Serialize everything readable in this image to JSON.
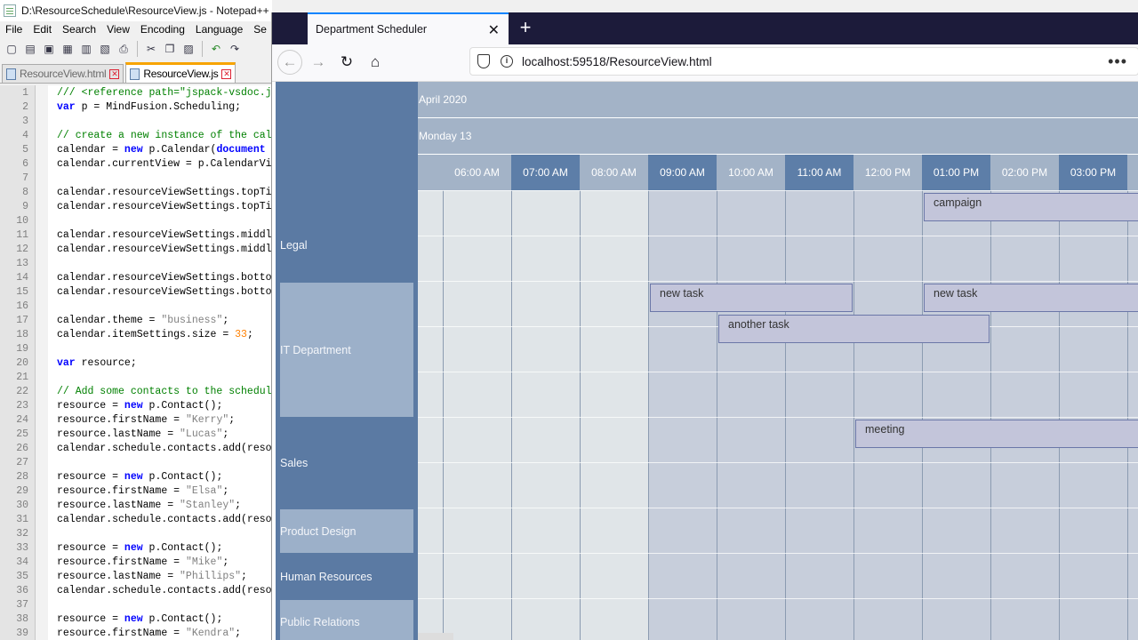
{
  "notepad": {
    "title": "D:\\ResourceSchedule\\ResourceView.js - Notepad++",
    "menu": [
      "File",
      "Edit",
      "Search",
      "View",
      "Encoding",
      "Language",
      "Se"
    ],
    "tabs": [
      {
        "label": "ResourceView.html",
        "active": false
      },
      {
        "label": "ResourceView.js",
        "active": true
      }
    ],
    "lines": [
      {
        "n": "1",
        "parts": [
          [
            "cm",
            "/// <reference path=\"jspack-vsdoc.j"
          ]
        ]
      },
      {
        "n": "2",
        "parts": [
          [
            "kw",
            "var"
          ],
          [
            "pl",
            " p = MindFusion.Scheduling;"
          ]
        ]
      },
      {
        "n": "3",
        "parts": []
      },
      {
        "n": "4",
        "parts": [
          [
            "cm",
            "// create a new instance of the cal"
          ]
        ]
      },
      {
        "n": "5",
        "parts": [
          [
            "pl",
            "calendar = "
          ],
          [
            "kw",
            "new"
          ],
          [
            "pl",
            " p.Calendar("
          ],
          [
            "kw",
            "document"
          ]
        ]
      },
      {
        "n": "6",
        "parts": [
          [
            "pl",
            "calendar.currentView = p.CalendarVi"
          ]
        ]
      },
      {
        "n": "7",
        "parts": []
      },
      {
        "n": "8",
        "parts": [
          [
            "pl",
            "calendar.resourceViewSettings.topTi"
          ]
        ]
      },
      {
        "n": "9",
        "parts": [
          [
            "pl",
            "calendar.resourceViewSettings.topTi"
          ]
        ]
      },
      {
        "n": "10",
        "parts": []
      },
      {
        "n": "11",
        "parts": [
          [
            "pl",
            "calendar.resourceViewSettings.middl"
          ]
        ]
      },
      {
        "n": "12",
        "parts": [
          [
            "pl",
            "calendar.resourceViewSettings.middl"
          ]
        ]
      },
      {
        "n": "13",
        "parts": []
      },
      {
        "n": "14",
        "parts": [
          [
            "pl",
            "calendar.resourceViewSettings.botto"
          ]
        ]
      },
      {
        "n": "15",
        "parts": [
          [
            "pl",
            "calendar.resourceViewSettings.botto"
          ]
        ]
      },
      {
        "n": "16",
        "parts": []
      },
      {
        "n": "17",
        "parts": [
          [
            "pl",
            "calendar.theme = "
          ],
          [
            "st",
            "\"business\""
          ],
          [
            "pl",
            ";"
          ]
        ]
      },
      {
        "n": "18",
        "parts": [
          [
            "pl",
            "calendar.itemSettings.size = "
          ],
          [
            "nm",
            "33"
          ],
          [
            "pl",
            ";"
          ]
        ]
      },
      {
        "n": "19",
        "parts": []
      },
      {
        "n": "20",
        "parts": [
          [
            "kw",
            "var"
          ],
          [
            "pl",
            " resource;"
          ]
        ]
      },
      {
        "n": "21",
        "parts": []
      },
      {
        "n": "22",
        "parts": [
          [
            "cm",
            "// Add some contacts to the schedul"
          ]
        ]
      },
      {
        "n": "23",
        "parts": [
          [
            "pl",
            "resource = "
          ],
          [
            "kw",
            "new"
          ],
          [
            "pl",
            " p.Contact();"
          ]
        ]
      },
      {
        "n": "24",
        "parts": [
          [
            "pl",
            "resource.firstName = "
          ],
          [
            "st",
            "\"Kerry\""
          ],
          [
            "pl",
            ";"
          ]
        ]
      },
      {
        "n": "25",
        "parts": [
          [
            "pl",
            "resource.lastName = "
          ],
          [
            "st",
            "\"Lucas\""
          ],
          [
            "pl",
            ";"
          ]
        ]
      },
      {
        "n": "26",
        "parts": [
          [
            "pl",
            "calendar.schedule.contacts.add(reso"
          ]
        ]
      },
      {
        "n": "27",
        "parts": []
      },
      {
        "n": "28",
        "parts": [
          [
            "pl",
            "resource = "
          ],
          [
            "kw",
            "new"
          ],
          [
            "pl",
            " p.Contact();"
          ]
        ]
      },
      {
        "n": "29",
        "parts": [
          [
            "pl",
            "resource.firstName = "
          ],
          [
            "st",
            "\"Elsa\""
          ],
          [
            "pl",
            ";"
          ]
        ]
      },
      {
        "n": "30",
        "parts": [
          [
            "pl",
            "resource.lastName = "
          ],
          [
            "st",
            "\"Stanley\""
          ],
          [
            "pl",
            ";"
          ]
        ]
      },
      {
        "n": "31",
        "parts": [
          [
            "pl",
            "calendar.schedule.contacts.add(reso"
          ]
        ]
      },
      {
        "n": "32",
        "parts": []
      },
      {
        "n": "33",
        "parts": [
          [
            "pl",
            "resource = "
          ],
          [
            "kw",
            "new"
          ],
          [
            "pl",
            " p.Contact();"
          ]
        ]
      },
      {
        "n": "34",
        "parts": [
          [
            "pl",
            "resource.firstName = "
          ],
          [
            "st",
            "\"Mike\""
          ],
          [
            "pl",
            ";"
          ]
        ]
      },
      {
        "n": "35",
        "parts": [
          [
            "pl",
            "resource.lastName = "
          ],
          [
            "st",
            "\"Phillips\""
          ],
          [
            "pl",
            ";"
          ]
        ]
      },
      {
        "n": "36",
        "parts": [
          [
            "pl",
            "calendar.schedule.contacts.add(reso"
          ]
        ]
      },
      {
        "n": "37",
        "parts": []
      },
      {
        "n": "38",
        "parts": [
          [
            "pl",
            "resource = "
          ],
          [
            "kw",
            "new"
          ],
          [
            "pl",
            " p.Contact();"
          ]
        ]
      },
      {
        "n": "39",
        "parts": [
          [
            "pl",
            "resource.firstName = "
          ],
          [
            "st",
            "\"Kendra\""
          ],
          [
            "pl",
            ";"
          ]
        ]
      }
    ]
  },
  "browser": {
    "tab_title": "Department Scheduler",
    "url": "localhost:59518/ResourceView.html"
  },
  "scheduler": {
    "month_label": "April 2020",
    "day_label": "Monday 13",
    "hours": [
      "06:00 AM",
      "07:00 AM",
      "08:00 AM",
      "09:00 AM",
      "10:00 AM",
      "11:00 AM",
      "12:00 PM",
      "01:00 PM",
      "02:00 PM",
      "03:00 PM",
      "04"
    ],
    "working_hours_start_index": 3,
    "resources": [
      "Legal",
      "IT Department",
      "Sales",
      "Product Design",
      "Human Resources",
      "Public Relations"
    ],
    "tasks": [
      {
        "title": "campaign",
        "resource": "Legal",
        "start": "01:00 PM",
        "end": "past 04:00 PM"
      },
      {
        "title": "new task",
        "resource": "IT Department",
        "start": "09:00 AM",
        "end": "12:00 PM"
      },
      {
        "title": "new task",
        "resource": "IT Department",
        "start": "01:00 PM",
        "end": "04:00 PM"
      },
      {
        "title": "another task",
        "resource": "IT Department",
        "start": "10:00 AM",
        "end": "02:00 PM"
      },
      {
        "title": "meeting",
        "resource": "Sales",
        "start": "12:00 PM",
        "end": "04:00 PM"
      }
    ],
    "colors": {
      "resource_bg": "#5b7aa3",
      "resource_alt_bg": "#9cb0c9",
      "header_bg": "#a3b3c7",
      "working_cell": "#c7cedb",
      "nonworking_cell": "#e0e5e8",
      "task_fill": "#c3c5da",
      "task_border": "#6b77a8"
    }
  }
}
